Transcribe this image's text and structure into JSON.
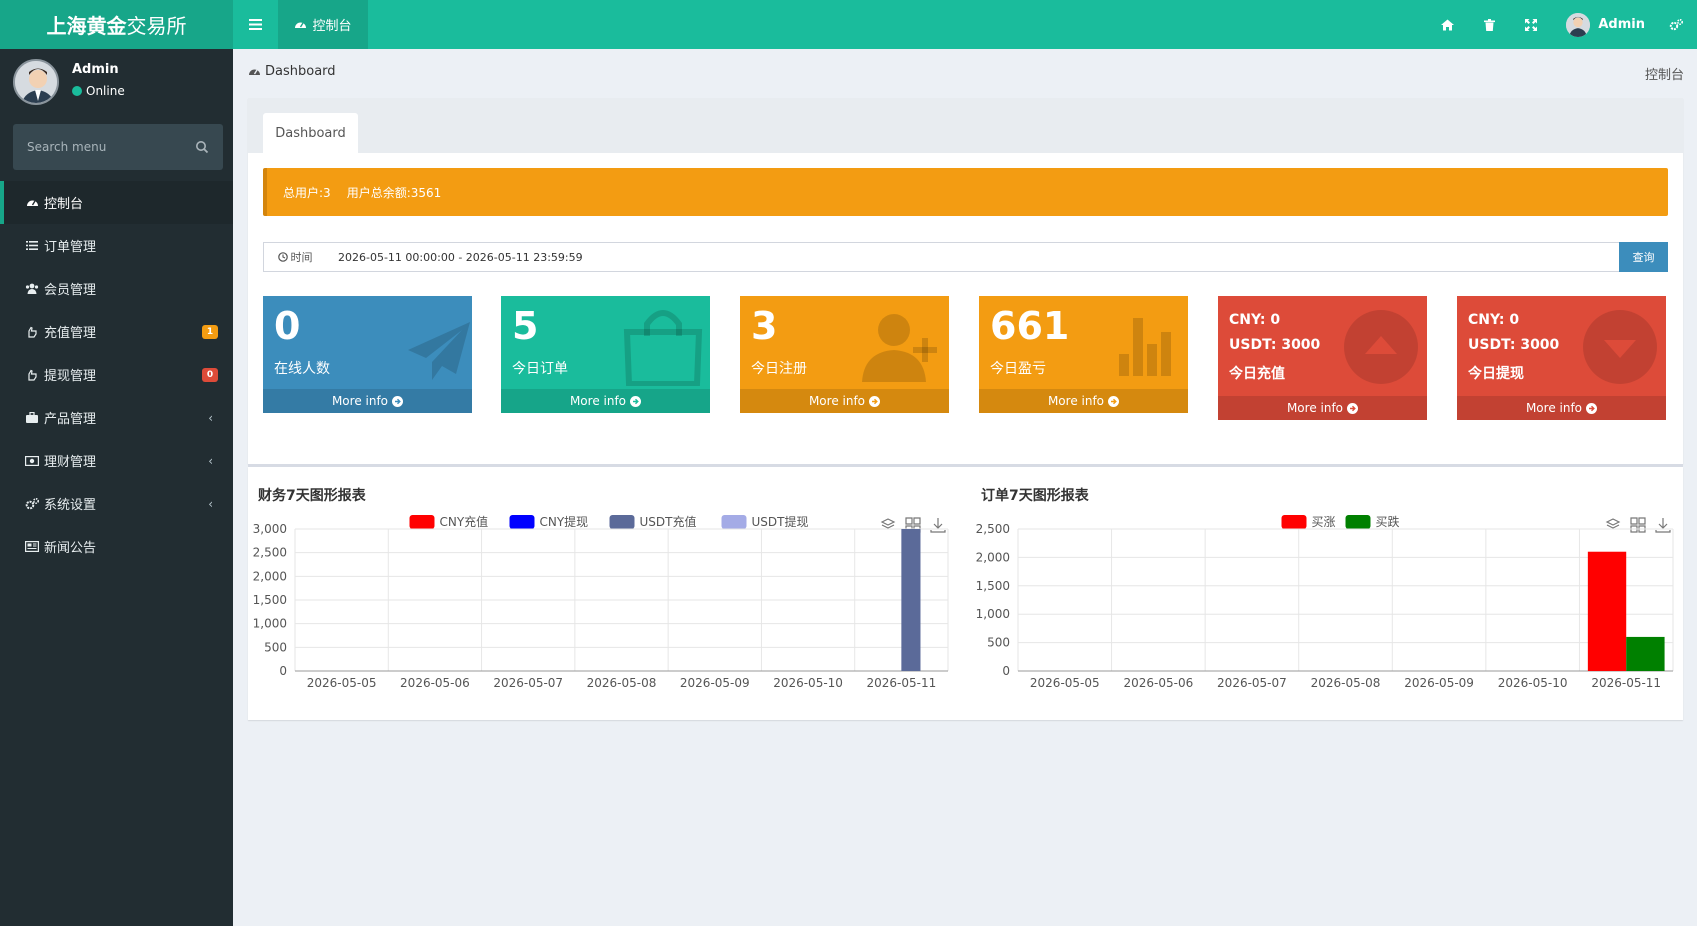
{
  "app": {
    "title_bold": "上海黄金",
    "title_rest": "交易所"
  },
  "header": {
    "nav_tab": "控制台",
    "admin_name": "Admin"
  },
  "sidebar": {
    "user_name": "Admin",
    "user_status": "Online",
    "search_placeholder": "Search menu",
    "items": [
      {
        "label": "控制台",
        "icon": "dashboard-icon"
      },
      {
        "label": "订单管理",
        "icon": "list-icon"
      },
      {
        "label": "会员管理",
        "icon": "users-icon"
      },
      {
        "label": "充值管理",
        "icon": "hand-icon",
        "badge": "1",
        "badge_color": "#f39c12"
      },
      {
        "label": "提现管理",
        "icon": "hand-icon",
        "badge": "0",
        "badge_color": "#dd4b39"
      },
      {
        "label": "产品管理",
        "icon": "briefcase-icon",
        "chevron": "‹"
      },
      {
        "label": "理财管理",
        "icon": "money-icon",
        "chevron": "‹"
      },
      {
        "label": "系统设置",
        "icon": "cogs-icon",
        "chevron": "‹"
      },
      {
        "label": "新闻公告",
        "icon": "newspaper-icon"
      }
    ]
  },
  "breadcrumb": {
    "left": "Dashboard",
    "right": "控制台"
  },
  "panel": {
    "tab": "Dashboard",
    "alert_users": "总用户:3",
    "alert_balance": "用户总余额:3561",
    "date_label": "时间",
    "date_range": "2026-05-11 00:00:00 - 2026-05-11 23:59:59",
    "query_button": "查询"
  },
  "cards": [
    {
      "value": "0",
      "label": "在线人数",
      "more": "More info",
      "color": "#3c8dbc"
    },
    {
      "value": "5",
      "label": "今日订单",
      "more": "More info",
      "color": "#1abc9c"
    },
    {
      "value": "3",
      "label": "今日注册",
      "more": "More info",
      "color": "#f39c12"
    },
    {
      "value": "661",
      "label": "今日盈亏",
      "more": "More info",
      "color": "#f39c12"
    },
    {
      "line1": "CNY:  0",
      "line2": "USDT:  3000",
      "line3": "今日充值",
      "more": "More info",
      "color": "#dd4b39"
    },
    {
      "line1": "CNY:  0",
      "line2": "USDT:  3000",
      "line3": "今日提现",
      "more": "More info",
      "color": "#dd4b39"
    }
  ],
  "chart_data": [
    {
      "type": "bar",
      "title": "财务7天图形报表",
      "categories": [
        "2026-05-05",
        "2026-05-06",
        "2026-05-07",
        "2026-05-08",
        "2026-05-09",
        "2026-05-10",
        "2026-05-11"
      ],
      "series": [
        {
          "name": "CNY充值",
          "color": "#ff0000",
          "values": [
            0,
            0,
            0,
            0,
            0,
            0,
            0
          ]
        },
        {
          "name": "CNY提现",
          "color": "#0000ff",
          "values": [
            0,
            0,
            0,
            0,
            0,
            0,
            0
          ]
        },
        {
          "name": "USDT充值",
          "color": "#5b6a99",
          "values": [
            0,
            0,
            0,
            0,
            0,
            0,
            3000
          ]
        },
        {
          "name": "USDT提现",
          "color": "#a4abe6",
          "values": [
            0,
            0,
            0,
            0,
            0,
            0,
            0
          ]
        }
      ],
      "yticks": [
        "0",
        "500",
        "1,000",
        "1,500",
        "2,000",
        "2,500",
        "3,000"
      ],
      "ylim": [
        0,
        3000
      ],
      "grid": true,
      "legend": "top-center"
    },
    {
      "type": "bar",
      "title": "订单7天图形报表",
      "categories": [
        "2026-05-05",
        "2026-05-06",
        "2026-05-07",
        "2026-05-08",
        "2026-05-09",
        "2026-05-10",
        "2026-05-11"
      ],
      "series": [
        {
          "name": "买涨",
          "color": "#ff0000",
          "values": [
            0,
            0,
            0,
            0,
            0,
            0,
            2100
          ]
        },
        {
          "name": "买跌",
          "color": "#008000",
          "values": [
            0,
            0,
            0,
            0,
            0,
            0,
            600
          ]
        }
      ],
      "yticks": [
        "0",
        "500",
        "1,000",
        "1,500",
        "2,000",
        "2,500"
      ],
      "ylim": [
        0,
        2500
      ],
      "grid": true,
      "legend": "top-center"
    }
  ]
}
